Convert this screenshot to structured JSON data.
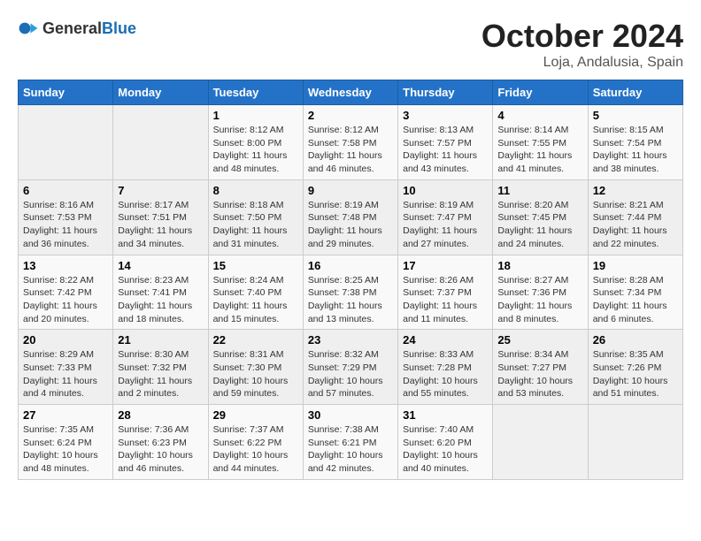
{
  "logo": {
    "general": "General",
    "blue": "Blue"
  },
  "title": "October 2024",
  "location": "Loja, Andalusia, Spain",
  "headers": [
    "Sunday",
    "Monday",
    "Tuesday",
    "Wednesday",
    "Thursday",
    "Friday",
    "Saturday"
  ],
  "weeks": [
    [
      {
        "day": "",
        "info": ""
      },
      {
        "day": "",
        "info": ""
      },
      {
        "day": "1",
        "info": "Sunrise: 8:12 AM\nSunset: 8:00 PM\nDaylight: 11 hours and 48 minutes."
      },
      {
        "day": "2",
        "info": "Sunrise: 8:12 AM\nSunset: 7:58 PM\nDaylight: 11 hours and 46 minutes."
      },
      {
        "day": "3",
        "info": "Sunrise: 8:13 AM\nSunset: 7:57 PM\nDaylight: 11 hours and 43 minutes."
      },
      {
        "day": "4",
        "info": "Sunrise: 8:14 AM\nSunset: 7:55 PM\nDaylight: 11 hours and 41 minutes."
      },
      {
        "day": "5",
        "info": "Sunrise: 8:15 AM\nSunset: 7:54 PM\nDaylight: 11 hours and 38 minutes."
      }
    ],
    [
      {
        "day": "6",
        "info": "Sunrise: 8:16 AM\nSunset: 7:53 PM\nDaylight: 11 hours and 36 minutes."
      },
      {
        "day": "7",
        "info": "Sunrise: 8:17 AM\nSunset: 7:51 PM\nDaylight: 11 hours and 34 minutes."
      },
      {
        "day": "8",
        "info": "Sunrise: 8:18 AM\nSunset: 7:50 PM\nDaylight: 11 hours and 31 minutes."
      },
      {
        "day": "9",
        "info": "Sunrise: 8:19 AM\nSunset: 7:48 PM\nDaylight: 11 hours and 29 minutes."
      },
      {
        "day": "10",
        "info": "Sunrise: 8:19 AM\nSunset: 7:47 PM\nDaylight: 11 hours and 27 minutes."
      },
      {
        "day": "11",
        "info": "Sunrise: 8:20 AM\nSunset: 7:45 PM\nDaylight: 11 hours and 24 minutes."
      },
      {
        "day": "12",
        "info": "Sunrise: 8:21 AM\nSunset: 7:44 PM\nDaylight: 11 hours and 22 minutes."
      }
    ],
    [
      {
        "day": "13",
        "info": "Sunrise: 8:22 AM\nSunset: 7:42 PM\nDaylight: 11 hours and 20 minutes."
      },
      {
        "day": "14",
        "info": "Sunrise: 8:23 AM\nSunset: 7:41 PM\nDaylight: 11 hours and 18 minutes."
      },
      {
        "day": "15",
        "info": "Sunrise: 8:24 AM\nSunset: 7:40 PM\nDaylight: 11 hours and 15 minutes."
      },
      {
        "day": "16",
        "info": "Sunrise: 8:25 AM\nSunset: 7:38 PM\nDaylight: 11 hours and 13 minutes."
      },
      {
        "day": "17",
        "info": "Sunrise: 8:26 AM\nSunset: 7:37 PM\nDaylight: 11 hours and 11 minutes."
      },
      {
        "day": "18",
        "info": "Sunrise: 8:27 AM\nSunset: 7:36 PM\nDaylight: 11 hours and 8 minutes."
      },
      {
        "day": "19",
        "info": "Sunrise: 8:28 AM\nSunset: 7:34 PM\nDaylight: 11 hours and 6 minutes."
      }
    ],
    [
      {
        "day": "20",
        "info": "Sunrise: 8:29 AM\nSunset: 7:33 PM\nDaylight: 11 hours and 4 minutes."
      },
      {
        "day": "21",
        "info": "Sunrise: 8:30 AM\nSunset: 7:32 PM\nDaylight: 11 hours and 2 minutes."
      },
      {
        "day": "22",
        "info": "Sunrise: 8:31 AM\nSunset: 7:30 PM\nDaylight: 10 hours and 59 minutes."
      },
      {
        "day": "23",
        "info": "Sunrise: 8:32 AM\nSunset: 7:29 PM\nDaylight: 10 hours and 57 minutes."
      },
      {
        "day": "24",
        "info": "Sunrise: 8:33 AM\nSunset: 7:28 PM\nDaylight: 10 hours and 55 minutes."
      },
      {
        "day": "25",
        "info": "Sunrise: 8:34 AM\nSunset: 7:27 PM\nDaylight: 10 hours and 53 minutes."
      },
      {
        "day": "26",
        "info": "Sunrise: 8:35 AM\nSunset: 7:26 PM\nDaylight: 10 hours and 51 minutes."
      }
    ],
    [
      {
        "day": "27",
        "info": "Sunrise: 7:35 AM\nSunset: 6:24 PM\nDaylight: 10 hours and 48 minutes."
      },
      {
        "day": "28",
        "info": "Sunrise: 7:36 AM\nSunset: 6:23 PM\nDaylight: 10 hours and 46 minutes."
      },
      {
        "day": "29",
        "info": "Sunrise: 7:37 AM\nSunset: 6:22 PM\nDaylight: 10 hours and 44 minutes."
      },
      {
        "day": "30",
        "info": "Sunrise: 7:38 AM\nSunset: 6:21 PM\nDaylight: 10 hours and 42 minutes."
      },
      {
        "day": "31",
        "info": "Sunrise: 7:40 AM\nSunset: 6:20 PM\nDaylight: 10 hours and 40 minutes."
      },
      {
        "day": "",
        "info": ""
      },
      {
        "day": "",
        "info": ""
      }
    ]
  ]
}
